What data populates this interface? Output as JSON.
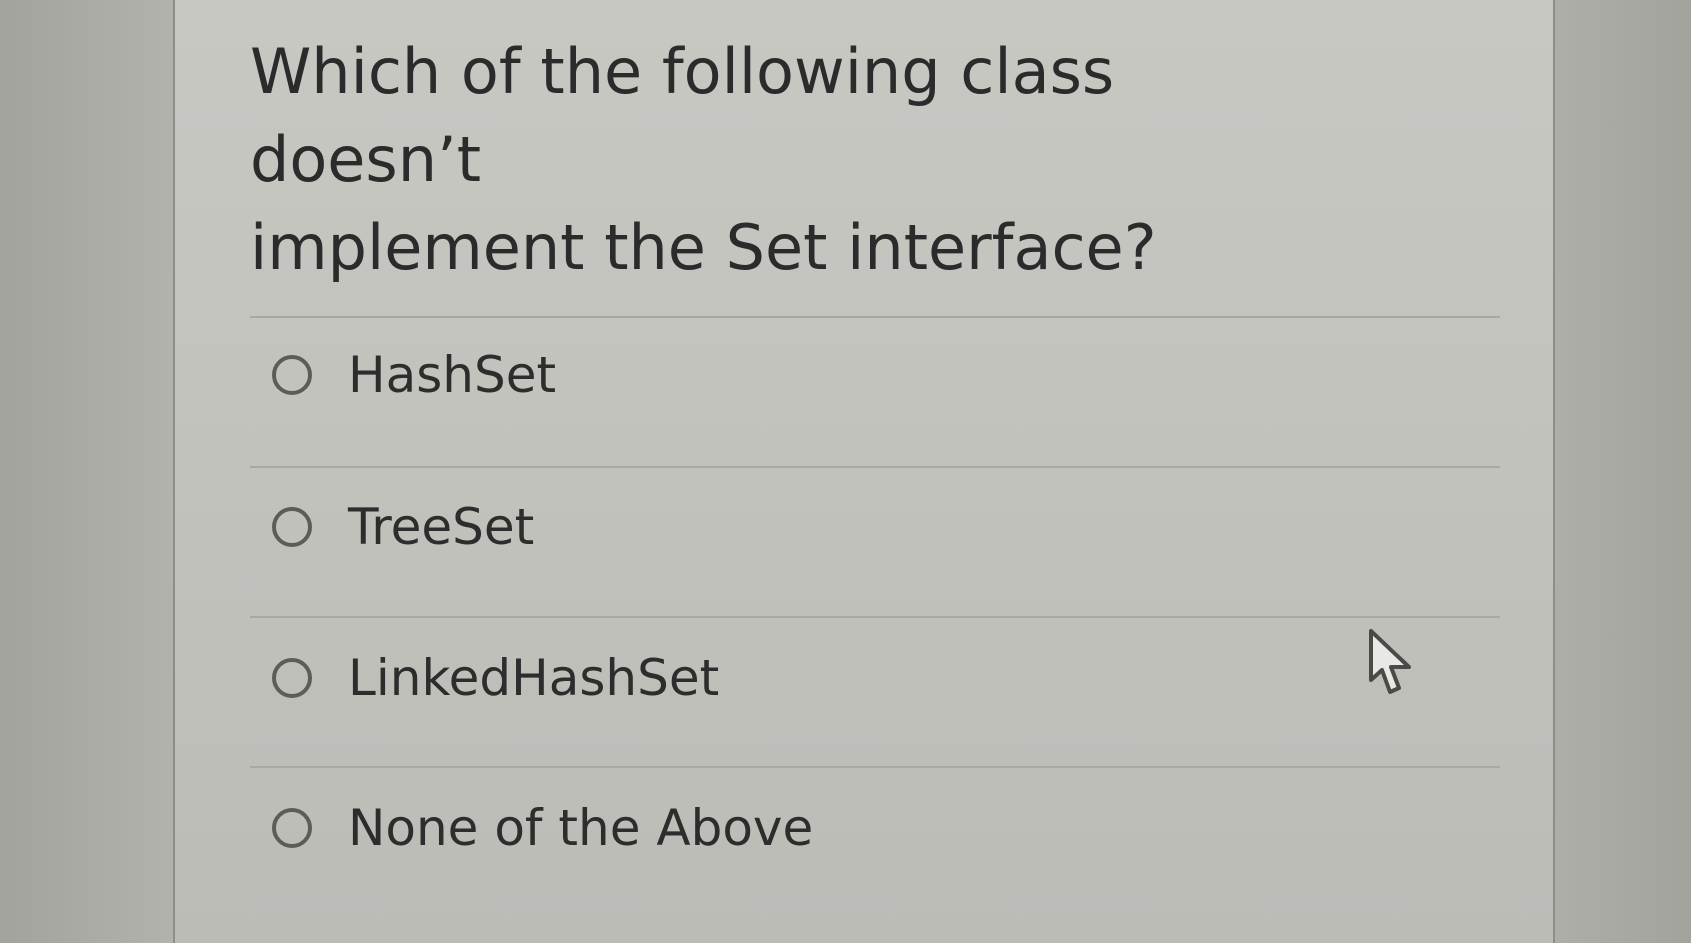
{
  "question": {
    "line1": "Which of the following class doesn’t",
    "line2": "implement the Set interface?"
  },
  "options": [
    {
      "label": "HashSet",
      "selected": false
    },
    {
      "label": "TreeSet",
      "selected": false
    },
    {
      "label": "LinkedHashSet",
      "selected": false
    },
    {
      "label": "None of the Above",
      "selected": false
    }
  ],
  "icons": {
    "radio": "radio-unchecked-icon",
    "cursor": "mouse-pointer-icon"
  },
  "colors": {
    "text": "#2b2b2b",
    "radio_border": "#5c5c5a",
    "panel_background": "#c3c3be"
  }
}
